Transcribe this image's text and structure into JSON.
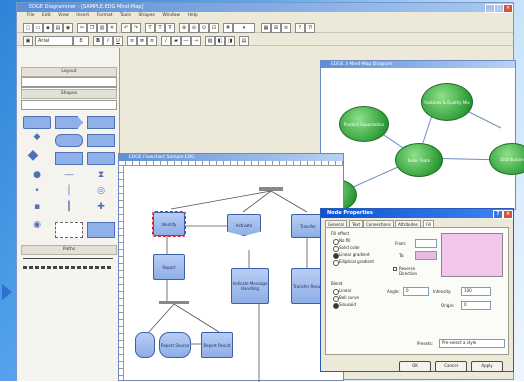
{
  "main_window": {
    "title": "EDGE Diagrammer - [SAMPLE.EDG Mind-Map]",
    "menu": [
      "File",
      "Edit",
      "View",
      "Insert",
      "Format",
      "Tools",
      "Shapes",
      "Window",
      "Help"
    ]
  },
  "toolbar": {
    "font_name": "Arial",
    "font_size": "8",
    "bold": "B",
    "italic": "I",
    "underline": "U"
  },
  "stencil": {
    "header_1": "Layout",
    "header_2": "Shapes",
    "header_3": "Paths"
  },
  "mind_map": {
    "title": "EDGE 3 Mind-Map Diagram",
    "nodes": [
      "Product Expectation",
      "Features & Quality Mix",
      "Sales Team",
      "Distribution"
    ]
  },
  "flow": {
    "title": "EDGE Flowchart Sample.EDG",
    "nodes": [
      "Identify",
      "Activate",
      "Transfer",
      "Report",
      "Indicate Message Handling",
      "Transfer Result",
      "Report Source",
      "Report Result"
    ]
  },
  "dialog": {
    "title": "Node Properties",
    "tabs": [
      "General",
      "Text",
      "Connections",
      "Attributes",
      "Fill"
    ],
    "fill_effect_label": "Fill effect",
    "fill_options": [
      "No fill",
      "Solid color",
      "Linear gradient",
      "Elliptical gradient"
    ],
    "from_label": "From:",
    "to_label": "To:",
    "reverse_label": "Reverse Direction",
    "blend_label": "Blend",
    "blend_options": [
      "Linear",
      "Bell curve",
      "Sinusoid"
    ],
    "angle_label": "Angle:",
    "angle_value": "0",
    "intensity_label": "Intensity:",
    "intensity_value": "100",
    "origin_label": "Origin:",
    "origin_value": "0",
    "preset_label": "Presets:",
    "preset_value": "Pre-select a style",
    "ok_label": "OK",
    "cancel_label": "Cancel",
    "apply_label": "Apply"
  },
  "colors": {
    "accent": "#0b53d4",
    "node_blue": "#8eaee6",
    "bubble_green": "#2f9e3a",
    "preview_pink": "#f2c6ea"
  }
}
